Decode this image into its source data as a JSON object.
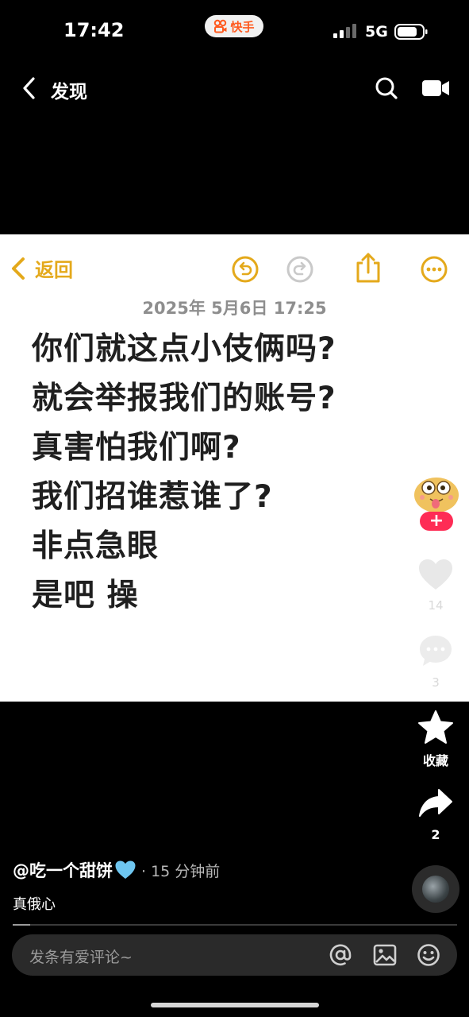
{
  "status_bar": {
    "time": "17:42",
    "app_name": "快手",
    "network": "5G"
  },
  "nav": {
    "title": "发现"
  },
  "note": {
    "back_label": "返回",
    "date": "2025年 5月6日 17:25",
    "lines": [
      "你们就这点小伎俩吗?",
      "就会举报我们的账号?",
      "真害怕我们啊?",
      "我们招谁惹谁了?",
      "非点急眼",
      "是吧 操"
    ],
    "accent_color": "#e4a91b"
  },
  "rail": {
    "likes": "14",
    "comments": "3",
    "favorite_label": "收藏",
    "shares": "2"
  },
  "post": {
    "author": "@吃一个甜饼",
    "time": "· 15 分钟前",
    "caption": "真俄心"
  },
  "playback": {
    "progress": 0.04
  },
  "comment_bar": {
    "placeholder": "发条有爱评论~"
  },
  "icons": [
    "chevron-left-icon",
    "search-icon",
    "video-icon",
    "undo-icon",
    "redo-icon",
    "share-icon",
    "more-icon",
    "heart-icon",
    "comment-icon",
    "star-icon",
    "share-arrow-icon",
    "at-icon",
    "image-icon",
    "emoji-icon"
  ]
}
